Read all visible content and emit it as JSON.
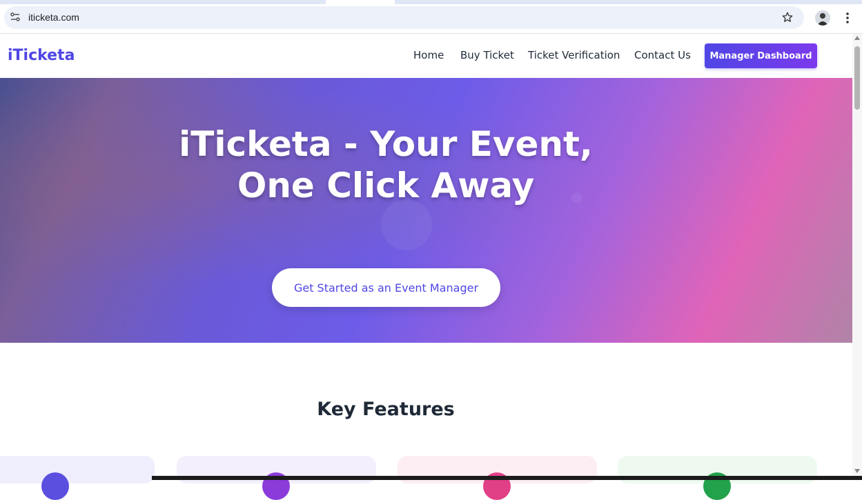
{
  "browser": {
    "url": "iticketa.com",
    "icons": {
      "site_info": "tune-icon",
      "bookmark": "star-icon",
      "profile": "avatar",
      "menu": "kebab-icon"
    }
  },
  "nav": {
    "brand": "iTicketa",
    "links": [
      "Home",
      "Buy Ticket",
      "Ticket Verification",
      "Contact Us"
    ],
    "dashboard_button": "Manager Dashboard"
  },
  "hero": {
    "title_line1": "iTicketa - Your Event,",
    "title_line2": "One Click Away",
    "cta": "Get Started as an Event Manager"
  },
  "features": {
    "heading": "Key Features"
  },
  "colors": {
    "brand": "#4f46e5",
    "accent_purple": "#7c3aed",
    "text_dark": "#1f2937"
  }
}
